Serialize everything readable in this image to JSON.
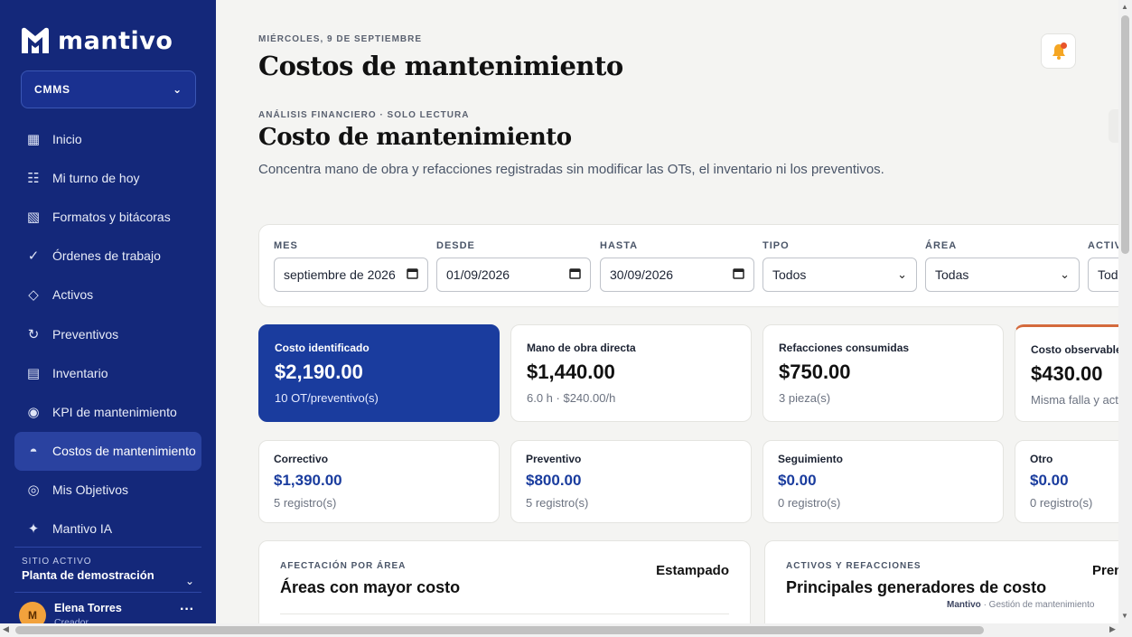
{
  "brand": {
    "name": "mantivo"
  },
  "module_select": {
    "value": "CMMS"
  },
  "nav": {
    "items": [
      {
        "label": "Inicio",
        "icon": "grid-icon"
      },
      {
        "label": "Mi turno de hoy",
        "icon": "checklist-icon"
      },
      {
        "label": "Formatos y bitácoras",
        "icon": "form-icon"
      },
      {
        "label": "Órdenes de trabajo",
        "icon": "check-icon"
      },
      {
        "label": "Activos",
        "icon": "diamond-icon"
      },
      {
        "label": "Preventivos",
        "icon": "refresh-icon"
      },
      {
        "label": "Inventario",
        "icon": "list-icon"
      },
      {
        "label": "KPI de mantenimiento",
        "icon": "target-dot-icon"
      },
      {
        "label": "Costos de mantenimiento",
        "icon": "half-circle-icon",
        "active": true
      },
      {
        "label": "Mis Objetivos",
        "icon": "bullseye-icon"
      },
      {
        "label": "Mantivo IA",
        "icon": "sparkle-icon"
      }
    ]
  },
  "site": {
    "label": "SITIO ACTIVO",
    "name": "Planta de demostración"
  },
  "user": {
    "initial": "M",
    "name": "Elena Torres",
    "role": "Creador"
  },
  "header": {
    "date": "MIÉRCOLES, 9 DE SEPTIEMBRE",
    "title": "Costos de mantenimiento"
  },
  "section": {
    "kicker": "ANÁLISIS FINANCIERO · SOLO LECTURA",
    "title": "Costo de mantenimiento",
    "description": "Concentra mano de obra y refacciones registradas sin modificar las OTs, el inventario ni los preventivos."
  },
  "filters": [
    {
      "label": "MES",
      "value": "septiembre de 2026",
      "icon": "calendar-icon"
    },
    {
      "label": "DESDE",
      "value": "01/09/2026",
      "icon": "calendar-icon"
    },
    {
      "label": "HASTA",
      "value": "30/09/2026",
      "icon": "calendar-icon"
    },
    {
      "label": "TIPO",
      "value": "Todos",
      "icon": "chevron-down-icon"
    },
    {
      "label": "ÁREA",
      "value": "Todas",
      "icon": "chevron-down-icon"
    },
    {
      "label": "ACTIVO",
      "value": "Todos",
      "icon": "chevron-down-icon"
    }
  ],
  "summary_cards": [
    {
      "label": "Costo identificado",
      "value": "$2,190.00",
      "sub": "10 OT/preventivo(s)"
    },
    {
      "label": "Mano de obra directa",
      "value": "$1,440.00",
      "sub": "6.0 h · $240.00/h"
    },
    {
      "label": "Refacciones consumidas",
      "value": "$750.00",
      "sub": "3 pieza(s)"
    },
    {
      "label": "Costo observable",
      "value": "$430.00",
      "sub": "Misma falla y activo"
    }
  ],
  "type_cards": [
    {
      "label": "Correctivo",
      "value": "$1,390.00",
      "sub": "5 registro(s)"
    },
    {
      "label": "Preventivo",
      "value": "$800.00",
      "sub": "5 registro(s)"
    },
    {
      "label": "Seguimiento",
      "value": "$0.00",
      "sub": "0 registro(s)"
    },
    {
      "label": "Otro",
      "value": "$0.00",
      "sub": "0 registro(s)"
    }
  ],
  "panels": [
    {
      "kicker": "AFECTACIÓN POR ÁREA",
      "title": "Áreas con mayor costo",
      "right": "Estampado"
    },
    {
      "kicker": "ACTIVOS Y REFACCIONES",
      "title": "Principales generadores de costo",
      "right": "Prensa"
    }
  ],
  "footer": {
    "brand": "Mantivo",
    "text": "· Gestión de mantenimiento"
  },
  "colors": {
    "sidebar": "#14287a",
    "primary": "#1a3c9e",
    "accent": "#d46a3c",
    "notification": "#e8542a"
  }
}
